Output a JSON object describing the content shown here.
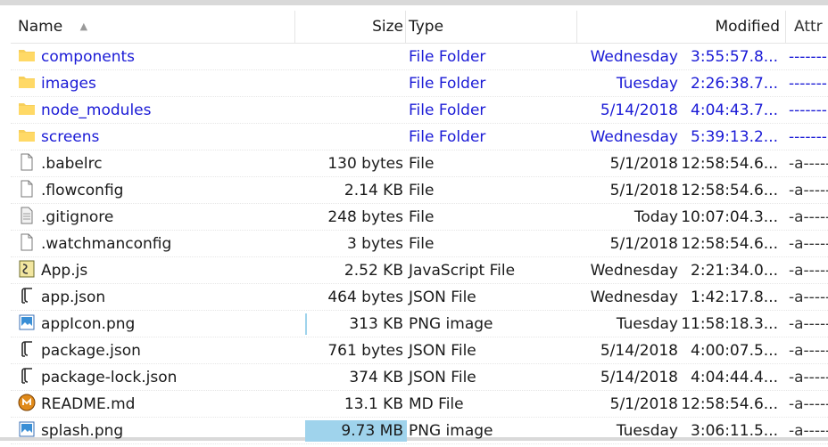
{
  "columns": {
    "name": "Name",
    "size": "Size",
    "type": "Type",
    "modified": "Modified",
    "attr": "Attr"
  },
  "accent_folder_color": "#1a1ad6",
  "size_bar_color": "#9fd3ec",
  "rows": [
    {
      "name": "components",
      "size": "",
      "type": "File Folder",
      "day": "Wednesday",
      "time": "3:55:57.8...",
      "attr": "-------",
      "icon": "folder-icon"
    },
    {
      "name": "images",
      "size": "",
      "type": "File Folder",
      "day": "Tuesday",
      "time": "2:26:38.7...",
      "attr": "-------",
      "icon": "folder-icon"
    },
    {
      "name": "node_modules",
      "size": "",
      "type": "File Folder",
      "day": "5/14/2018",
      "time": "4:04:43.7...",
      "attr": "-------",
      "icon": "folder-icon"
    },
    {
      "name": "screens",
      "size": "",
      "type": "File Folder",
      "day": "Wednesday",
      "time": "5:39:13.2...",
      "attr": "-------",
      "icon": "folder-icon"
    },
    {
      "name": ".babelrc",
      "size": "130 bytes",
      "type": "File",
      "day": "5/1/2018",
      "time": "12:58:54.6...",
      "attr": "-a-----",
      "icon": "blank-file-icon"
    },
    {
      "name": ".flowconfig",
      "size": "2.14 KB",
      "type": "File",
      "day": "5/1/2018",
      "time": "12:58:54.6...",
      "attr": "-a-----",
      "icon": "blank-file-icon"
    },
    {
      "name": ".gitignore",
      "size": "248 bytes",
      "type": "File",
      "day": "Today",
      "time": "10:07:04.3...",
      "attr": "-a-----",
      "icon": "text-file-icon"
    },
    {
      "name": ".watchmanconfig",
      "size": "3 bytes",
      "type": "File",
      "day": "5/1/2018",
      "time": "12:58:54.6...",
      "attr": "-a-----",
      "icon": "blank-file-icon"
    },
    {
      "name": "App.js",
      "size": "2.52 KB",
      "type": "JavaScript File",
      "day": "Wednesday",
      "time": "2:21:34.0...",
      "attr": "-a-----",
      "icon": "script-file-icon"
    },
    {
      "name": "app.json",
      "size": "464 bytes",
      "type": "JSON File",
      "day": "Wednesday",
      "time": "1:42:17.8...",
      "attr": "-a-----",
      "icon": "json-file-icon"
    },
    {
      "name": "appIcon.png",
      "size": "313 KB",
      "type": "PNG image",
      "day": "Tuesday",
      "time": "11:58:18.3...",
      "attr": "-a-----",
      "icon": "image-file-icon",
      "size_fraction": 0.03
    },
    {
      "name": "package.json",
      "size": "761 bytes",
      "type": "JSON File",
      "day": "5/14/2018",
      "time": "4:00:07.5...",
      "attr": "-a-----",
      "icon": "json-file-icon"
    },
    {
      "name": "package-lock.json",
      "size": "374 KB",
      "type": "JSON File",
      "day": "5/14/2018",
      "time": "4:04:44.4...",
      "attr": "-a-----",
      "icon": "json-file-icon"
    },
    {
      "name": "README.md",
      "size": "13.1 KB",
      "type": "MD File",
      "day": "5/1/2018",
      "time": "12:58:54.6...",
      "attr": "-a-----",
      "icon": "markdown-file-icon"
    },
    {
      "name": "splash.png",
      "size": "9.73 MB",
      "type": "PNG image",
      "day": "Tuesday",
      "time": "3:06:11.5...",
      "attr": "-a-----",
      "icon": "image-file-icon",
      "size_fraction": 1.0
    }
  ]
}
